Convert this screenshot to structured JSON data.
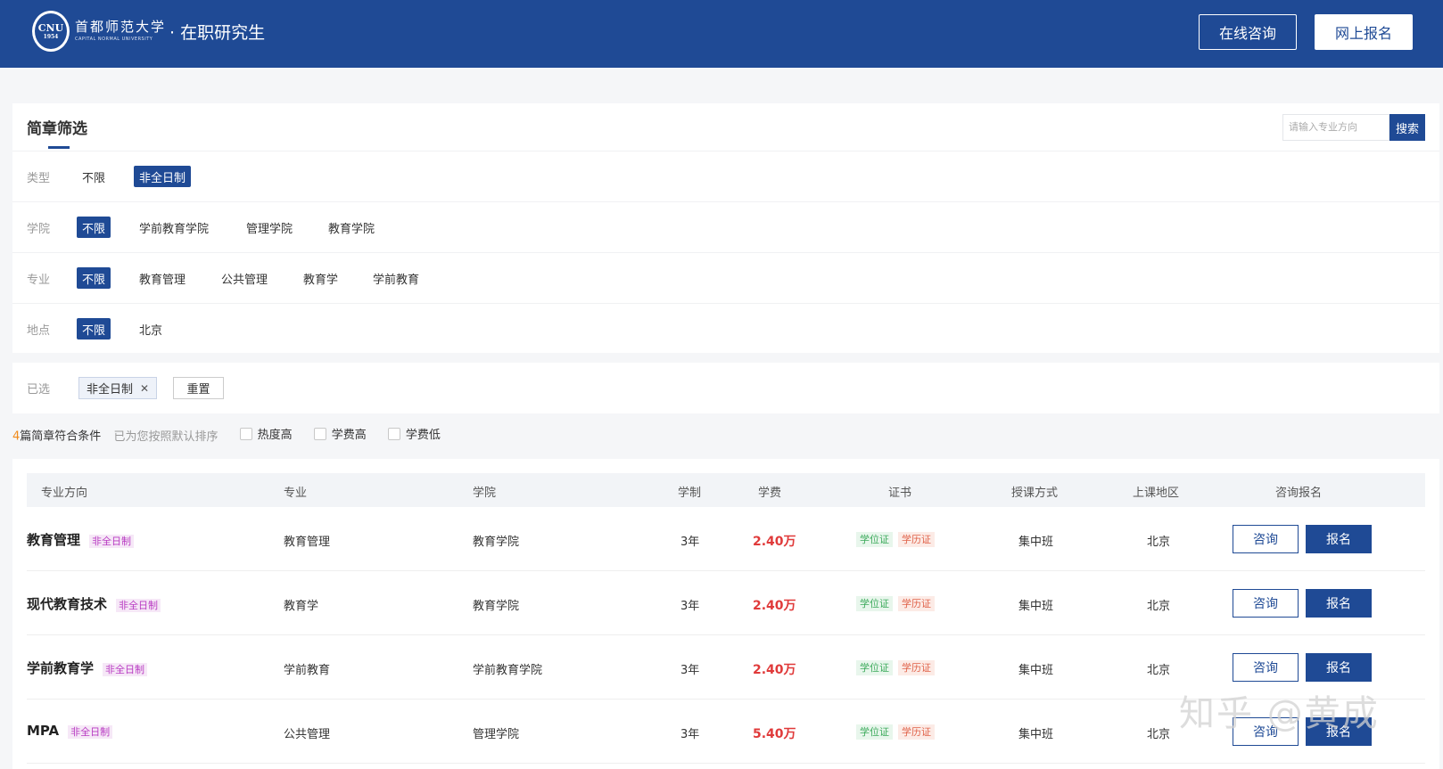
{
  "header": {
    "logo_text": "CNU",
    "logo_year": "1954",
    "school_cn": "首都师范大学",
    "school_en": "CAPITAL NORMAL UNIVERSITY",
    "subtitle": "· 在职研究生",
    "consult_label": "在线咨询",
    "enroll_label": "网上报名",
    "brand_color": "#1f4a95"
  },
  "filters": {
    "title": "简章筛选",
    "search_placeholder": "请输入专业方向",
    "search_label": "搜索",
    "rows": [
      {
        "label": "类型",
        "options": [
          "不限",
          "非全日制"
        ],
        "active": 1
      },
      {
        "label": "学院",
        "options": [
          "不限",
          "学前教育学院",
          "管理学院",
          "教育学院"
        ],
        "active": 0
      },
      {
        "label": "专业",
        "options": [
          "不限",
          "教育管理",
          "公共管理",
          "教育学",
          "学前教育"
        ],
        "active": 0
      },
      {
        "label": "地点",
        "options": [
          "不限",
          "北京"
        ],
        "active": 0
      }
    ]
  },
  "selected": {
    "label": "已选",
    "chip": "非全日制",
    "chip_close": "✕",
    "reset_label": "重置"
  },
  "sort": {
    "count": "4",
    "count_text": "篇简章符合条件",
    "hint": "已为您按照默认排序",
    "options": [
      "热度高",
      "学费高",
      "学费低"
    ]
  },
  "table": {
    "headers": [
      "专业方向",
      "专业",
      "学院",
      "学制",
      "学费",
      "证书",
      "授课方式",
      "上课地区",
      "咨询报名"
    ],
    "rows": [
      {
        "name": "教育管理",
        "tag": "非全日制",
        "major": "教育管理",
        "college": "教育学院",
        "duration": "3年",
        "fee": "2.40万",
        "cert1": "学位证",
        "cert2": "学历证",
        "mode": "集中班",
        "area": "北京",
        "consult": "咨询",
        "enroll": "报名"
      },
      {
        "name": "现代教育技术",
        "tag": "非全日制",
        "major": "教育学",
        "college": "教育学院",
        "duration": "3年",
        "fee": "2.40万",
        "cert1": "学位证",
        "cert2": "学历证",
        "mode": "集中班",
        "area": "北京",
        "consult": "咨询",
        "enroll": "报名"
      },
      {
        "name": "学前教育学",
        "tag": "非全日制",
        "major": "学前教育",
        "college": "学前教育学院",
        "duration": "3年",
        "fee": "2.40万",
        "cert1": "学位证",
        "cert2": "学历证",
        "mode": "集中班",
        "area": "北京",
        "consult": "咨询",
        "enroll": "报名"
      },
      {
        "name": "MPA",
        "tag": "非全日制",
        "major": "公共管理",
        "college": "管理学院",
        "duration": "3年",
        "fee": "5.40万",
        "cert1": "学位证",
        "cert2": "学历证",
        "mode": "集中班",
        "area": "北京",
        "consult": "咨询",
        "enroll": "报名"
      }
    ]
  },
  "watermark": "知乎 @黄成"
}
